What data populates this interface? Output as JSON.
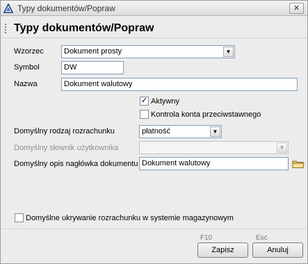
{
  "window": {
    "title": "Typy dokumentów/Popraw",
    "close_glyph": "✕",
    "icon": "app-triangle-icon"
  },
  "header": {
    "title": "Typy dokumentów/Popraw"
  },
  "form": {
    "wzorzec": {
      "label": "Wzorzec",
      "value": "Dokument prosty"
    },
    "symbol": {
      "label": "Symbol",
      "value": "DW"
    },
    "nazwa": {
      "label": "Nazwa",
      "value": "Dokument walutowy"
    },
    "aktywny": {
      "label": "Aktywny",
      "checked": true
    },
    "kontrola": {
      "label": "Kontrola konta przeciwstawnego",
      "checked": false
    },
    "rodzaj_rozrachunku": {
      "label": "Domyślny rodzaj rozrachunku",
      "value": "płatność"
    },
    "slownik_uzytkownika": {
      "label": "Domyślny słownik użytkownika",
      "value": "",
      "disabled": true
    },
    "opis_naglowka": {
      "label": "Domyślny opis nagłówka dokumentu",
      "value": "Dokument walutowy"
    },
    "ukrywanie": {
      "label": "Domyślne ukrywanie rozrachunku w systemie magazynowym",
      "checked": false
    }
  },
  "footer": {
    "save": {
      "label": "Zapisz",
      "shortcut": "F10"
    },
    "cancel": {
      "label": "Anuluj",
      "shortcut": "Esc"
    }
  },
  "colors": {
    "accent": "#1c4a8c",
    "field_border": "#7f9db9",
    "disabled_text": "#8f8f8f"
  }
}
